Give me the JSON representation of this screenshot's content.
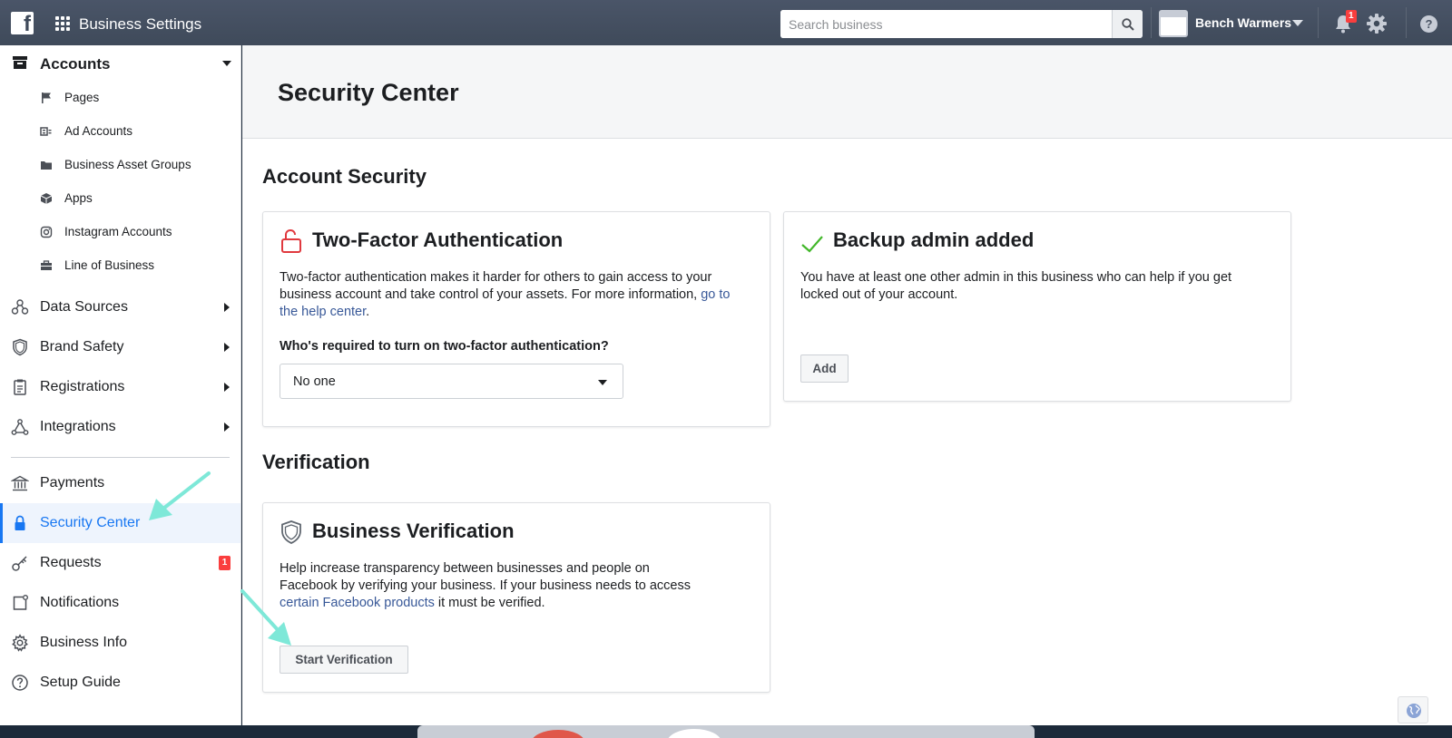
{
  "topbar": {
    "logo_letter": "f",
    "title": "Business Settings",
    "search_placeholder": "Search business",
    "business_name": "Bench Warmers",
    "notification_count": "1",
    "help_label": "?"
  },
  "sidebar": {
    "accounts": {
      "label": "Accounts",
      "items": [
        {
          "label": "Pages",
          "icon": "flag-icon"
        },
        {
          "label": "Ad Accounts",
          "icon": "ad-account-icon"
        },
        {
          "label": "Business Asset Groups",
          "icon": "folder-icon"
        },
        {
          "label": "Apps",
          "icon": "cube-icon"
        },
        {
          "label": "Instagram Accounts",
          "icon": "instagram-icon"
        },
        {
          "label": "Line of Business",
          "icon": "briefcase-icon"
        }
      ]
    },
    "groups": [
      {
        "label": "Data Sources",
        "icon": "data-sources-icon"
      },
      {
        "label": "Brand Safety",
        "icon": "shield-icon"
      },
      {
        "label": "Registrations",
        "icon": "clipboard-icon"
      },
      {
        "label": "Integrations",
        "icon": "integrations-icon"
      }
    ],
    "items": [
      {
        "label": "Payments",
        "icon": "bank-icon"
      },
      {
        "label": "Security Center",
        "icon": "lock-icon",
        "active": true
      },
      {
        "label": "Requests",
        "icon": "key-icon",
        "badge": "1"
      },
      {
        "label": "Notifications",
        "icon": "notification-icon"
      },
      {
        "label": "Business Info",
        "icon": "gear-icon"
      },
      {
        "label": "Setup Guide",
        "icon": "question-icon"
      }
    ]
  },
  "main": {
    "page_title": "Security Center",
    "account_security": {
      "section_title": "Account Security",
      "two_factor": {
        "title": "Two-Factor Authentication",
        "body_lines": [
          "Two-factor authentication makes it harder for others to gain access to your",
          "business account and take control of your assets. For more information,"
        ],
        "link_1": "go to",
        "link_2": "the help center",
        "period": ".",
        "question": "Who's required to turn on two-factor authentication?",
        "select_value": "No one"
      },
      "backup_admin": {
        "title": "Backup admin added",
        "body_lines": [
          "You have at least one other admin in this business who can help if you get",
          "locked out of your account."
        ],
        "add_button": "Add"
      }
    },
    "verification": {
      "section_title": "Verification",
      "business_verification": {
        "title": "Business Verification",
        "body_lines": [
          "Help increase transparency between businesses and people on",
          "Facebook by verifying your business. If your business needs to access"
        ],
        "link": "certain Facebook products",
        "body_tail": " it must be verified.",
        "button": "Start Verification"
      }
    }
  },
  "colors": {
    "topbar": "#3f4a5a",
    "accent": "#1877f2",
    "link": "#385898",
    "alert_red": "#e0393e",
    "check_green": "#42b72a",
    "annotation_arrow": "#7ee8d8"
  }
}
